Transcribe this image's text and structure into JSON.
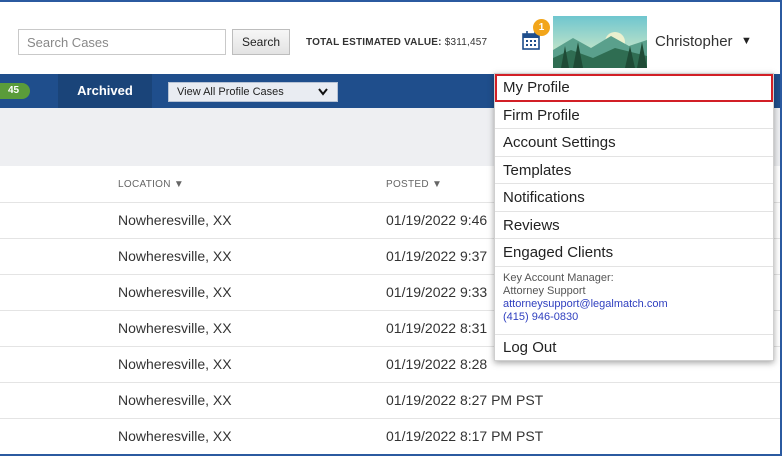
{
  "header": {
    "search_placeholder": "Search Cases",
    "search_label": "Search",
    "total_label": "TOTAL ESTIMATED VALUE:",
    "total_value": "$311,457",
    "calendar_badge": "1",
    "username": "Christopher",
    "caret": "▼"
  },
  "tabbar": {
    "count_fragment": "45",
    "archived_label": "Archived",
    "view_select_value": "View All Profile Cases",
    "chevron": "❯"
  },
  "table": {
    "headers": {
      "location": "LOCATION ▼",
      "posted": "POSTED ▼"
    },
    "rows": [
      {
        "location": "Nowheresville, XX",
        "posted": "01/19/2022 9:46"
      },
      {
        "location": "Nowheresville, XX",
        "posted": "01/19/2022 9:37"
      },
      {
        "location": "Nowheresville, XX",
        "posted": "01/19/2022 9:33"
      },
      {
        "location": "Nowheresville, XX",
        "posted": "01/19/2022 8:31"
      },
      {
        "location": "Nowheresville, XX",
        "posted": "01/19/2022 8:28"
      },
      {
        "location": "Nowheresville, XX",
        "posted": "01/19/2022 8:27 PM PST"
      },
      {
        "location": "Nowheresville, XX",
        "posted": "01/19/2022 8:17 PM PST"
      }
    ]
  },
  "menu": {
    "items": [
      "My Profile",
      "Firm Profile",
      "Account Settings",
      "Templates",
      "Notifications",
      "Reviews",
      "Engaged Clients"
    ],
    "kam_title": "Key Account Manager:",
    "kam_name": "Attorney Support",
    "kam_email": "attorneysupport@legalmatch.com",
    "kam_phone": "(415) 946-0830",
    "logout": "Log Out"
  },
  "colors": {
    "nav_blue": "#1f4e8c",
    "badge_orange": "#f2a51a",
    "active_border": "#d21f26",
    "link_blue": "#2f3fbf"
  }
}
